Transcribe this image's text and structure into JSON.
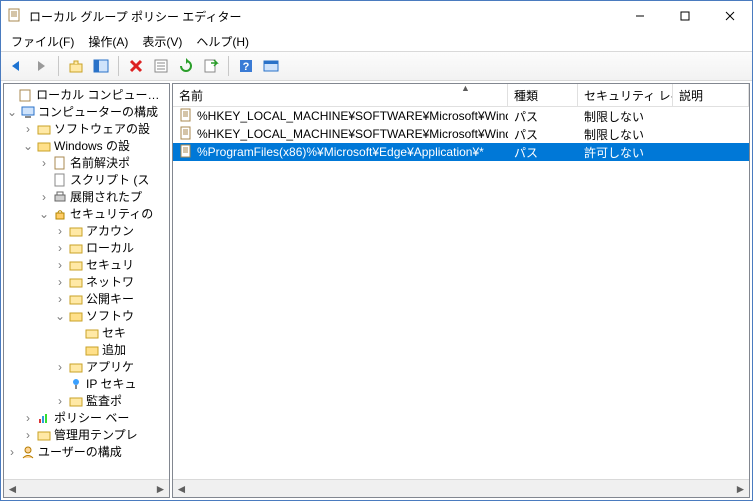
{
  "window": {
    "title": "ローカル グループ ポリシー エディター"
  },
  "menu": {
    "file": "ファイル(F)",
    "action": "操作(A)",
    "view": "表示(V)",
    "help": "ヘルプ(H)"
  },
  "tree": {
    "root": "ローカル コンピューター ポ",
    "computer": "コンピューターの構成",
    "software": "ソフトウェアの設",
    "windows": "Windows の設",
    "name_res": "名前解決ポ",
    "scripts": "スクリプト (ス",
    "deployed": "展開されたプ",
    "security": "セキュリティの",
    "account": "アカウン",
    "local_": "ローカル",
    "secu2": "セキュリ",
    "network": "ネットワ",
    "public": "公開キー",
    "soft2": "ソフトウ",
    "seki": "セキ",
    "add": "追加",
    "app": "アプリケ",
    "ipsec": "IP セキュ",
    "audit": "監査ポ",
    "policy_base": "ポリシー ベー",
    "admin": "管理用テンプレ",
    "user": "ユーザーの構成"
  },
  "columns": {
    "name": "名前",
    "type": "種類",
    "security": "セキュリティ レベル",
    "desc": "説明"
  },
  "rows": [
    {
      "name": "%HKEY_LOCAL_MACHINE¥SOFTWARE¥Microsoft¥Windo...",
      "type": "パス",
      "security": "制限しない",
      "selected": false
    },
    {
      "name": "%HKEY_LOCAL_MACHINE¥SOFTWARE¥Microsoft¥Windo...",
      "type": "パス",
      "security": "制限しない",
      "selected": false
    },
    {
      "name": "%ProgramFiles(x86)%¥Microsoft¥Edge¥Application¥*",
      "type": "パス",
      "security": "許可しない",
      "selected": true
    }
  ]
}
